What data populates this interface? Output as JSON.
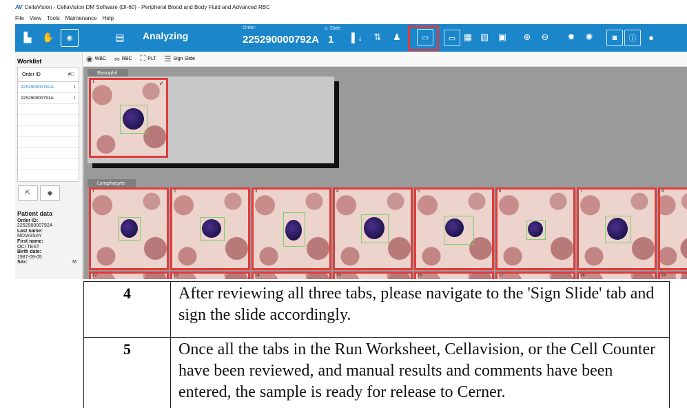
{
  "window": {
    "logo": "AV",
    "title": "CellaVision - CellaVision DM Software (DI-60) - Peripheral Blood and Body Fluid and Advanced RBC"
  },
  "menu": [
    "File",
    "View",
    "Tools",
    "Maintenance",
    "Help"
  ],
  "toolbar": {
    "status": "Analyzing",
    "order_label": "Order:",
    "order_value": "225290000792A",
    "slide_label": "Slide:",
    "slide_value": "1",
    "highlighted_icon": "monitor-check-icon"
  },
  "worklist": {
    "title": "Worklist",
    "col_order": "Order ID",
    "col_slide_icon": "slide-count-icon",
    "rows": [
      {
        "order": "225290000792A",
        "slide": "1",
        "selected": true
      },
      {
        "order": "225290000791A",
        "slide": "1",
        "selected": false
      }
    ]
  },
  "patient": {
    "title": "Patient data",
    "order_id_label": "Order ID:",
    "order_id": "225290000792A",
    "last_name_label": "Last name:",
    "last_name": "MDIASSAY",
    "first_name_label": "First name:",
    "first_name": "OCI TEST",
    "birth_label": "Birth date:",
    "birth": "1987-09-05",
    "sex_label": "Sex:",
    "sex": "M"
  },
  "tabs": [
    {
      "label": "WBC",
      "icon": "wbc-icon"
    },
    {
      "label": "RBC",
      "icon": "rbc-icon"
    },
    {
      "label": "PLT",
      "icon": "plt-icon"
    },
    {
      "label": "Sign Slide",
      "icon": "sign-slide-icon"
    }
  ],
  "categories": {
    "basophil": {
      "label": "Basophil",
      "cells": [
        "1"
      ]
    },
    "lymphocyte": {
      "label": "Lymphocyte",
      "cells": [
        "1",
        "2",
        "3",
        "4",
        "5",
        "6",
        "7",
        "8"
      ],
      "next_row": [
        "12",
        "13",
        "14",
        "15",
        "16",
        "17",
        "18",
        "19"
      ]
    }
  },
  "doc": {
    "rows": [
      {
        "number": "4",
        "text": "After reviewing all three tabs, please navigate to the 'Sign Slide' tab and sign the slide accordingly."
      },
      {
        "number": "5",
        "text": "Once all the tabs in the Run Worksheet, Cellavision, or the Cell Counter have been reviewed, and manual results and comments have been entered, the sample is ready for release to Cerner."
      }
    ]
  },
  "colors": {
    "toolbar": "#1b86c9",
    "highlight": "#e0393e",
    "cell_border": "#e13b3b"
  }
}
